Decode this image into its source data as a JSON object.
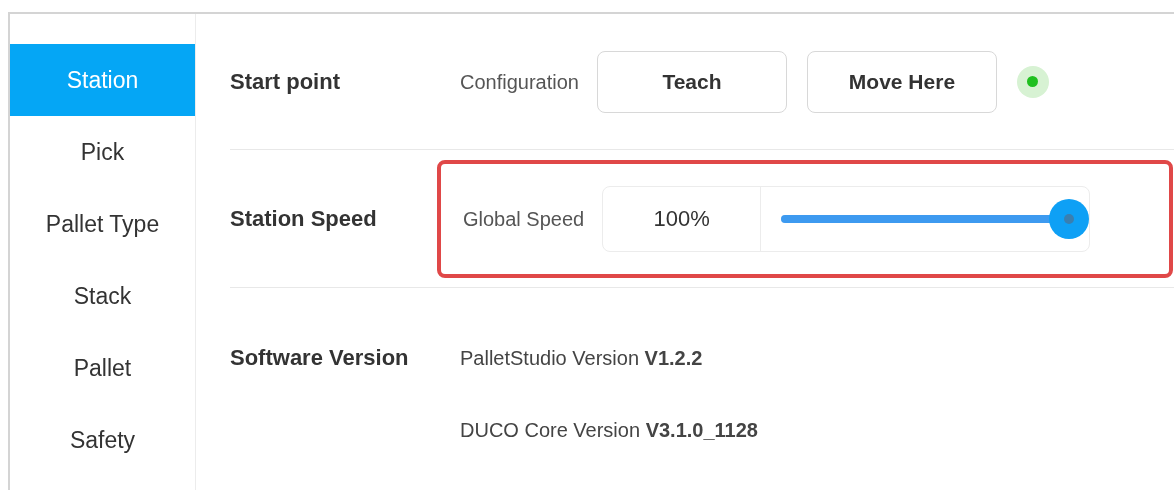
{
  "sidebar": {
    "items": [
      {
        "label": "Station",
        "selected": true
      },
      {
        "label": "Pick",
        "selected": false
      },
      {
        "label": "Pallet Type",
        "selected": false
      },
      {
        "label": "Stack",
        "selected": false
      },
      {
        "label": "Pallet",
        "selected": false
      },
      {
        "label": "Safety",
        "selected": false
      }
    ]
  },
  "start_point": {
    "title": "Start point",
    "label": "Configuration",
    "buttons": [
      "Teach",
      "Move Here"
    ],
    "indicator": {
      "on": true
    }
  },
  "station_speed": {
    "title": "Station Speed",
    "label": "Global Speed",
    "value": "100%",
    "level": 1,
    "highlighted": true
  },
  "software_version": {
    "title": "Software Version",
    "lines": [
      "PalletStudio Version **V1.2.2**",
      "DUCO Core Version **V3.1.0_1128**"
    ]
  }
}
